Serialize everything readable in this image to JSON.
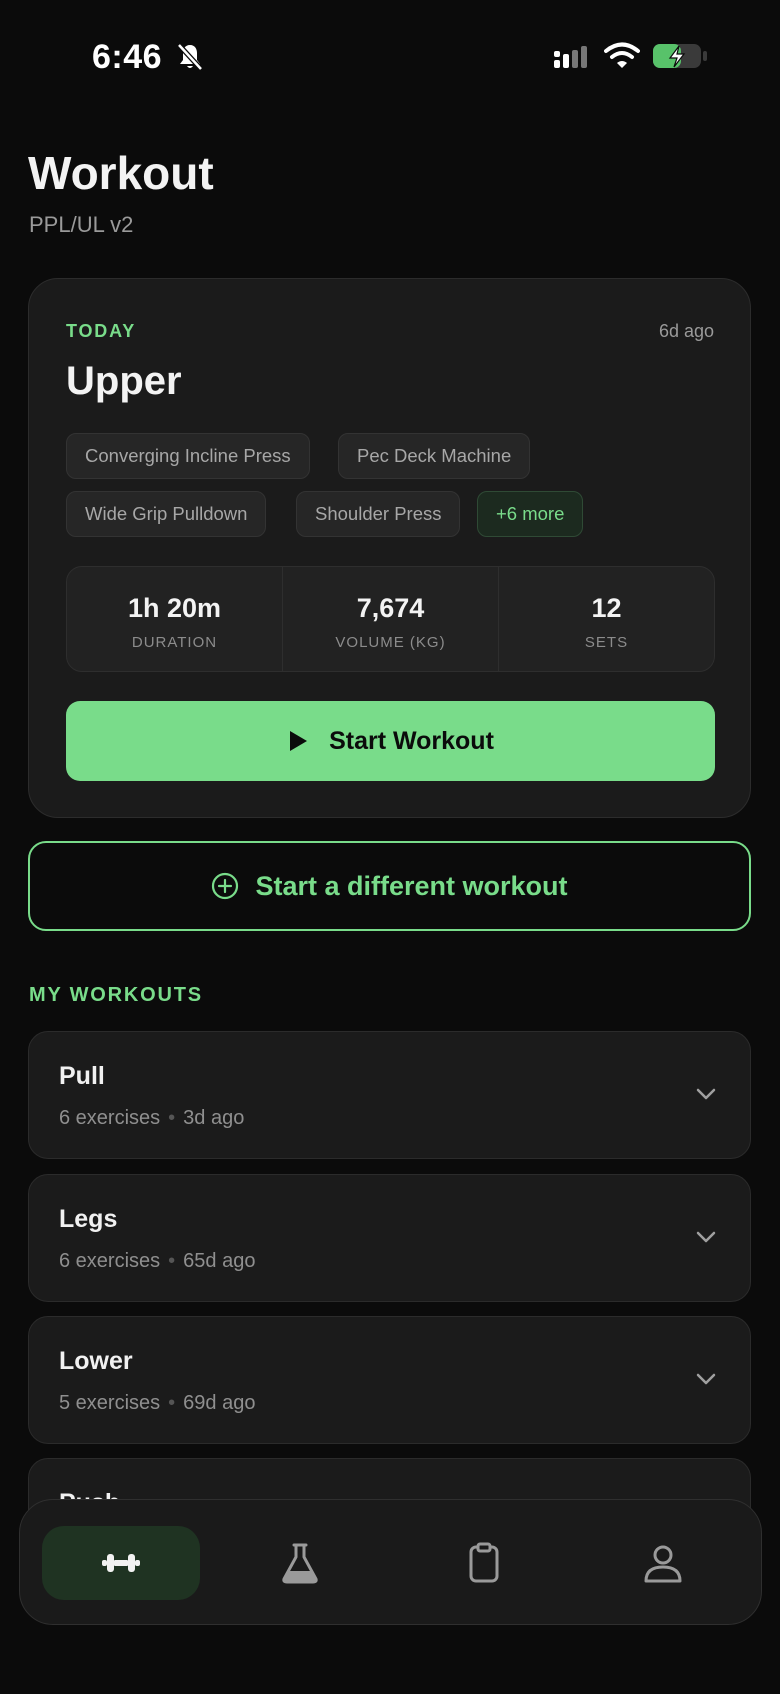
{
  "status_bar": {
    "time": "6:46",
    "icons": [
      "bell-off-icon",
      "signal-icon",
      "wifi-icon",
      "battery-charging-icon"
    ]
  },
  "header": {
    "title": "Workout",
    "subtitle": "PPL/UL v2"
  },
  "today": {
    "label": "TODAY",
    "ago": "6d ago",
    "name": "Upper",
    "exercises": [
      "Converging Incline Press",
      "Pec Deck Machine",
      "Wide Grip Pulldown",
      "Shoulder Press"
    ],
    "more": "+6 more",
    "stats": [
      {
        "value": "1h 20m",
        "label": "DURATION"
      },
      {
        "value": "7,674",
        "label": "VOLUME (KG)"
      },
      {
        "value": "12",
        "label": "SETS"
      }
    ],
    "start_label": "Start Workout"
  },
  "different_workout_label": "Start a different workout",
  "my_workouts": {
    "title": "MY WORKOUTS",
    "items": [
      {
        "name": "Pull",
        "exercises": "6 exercises",
        "ago": "3d ago"
      },
      {
        "name": "Legs",
        "exercises": "6 exercises",
        "ago": "65d ago"
      },
      {
        "name": "Lower",
        "exercises": "5 exercises",
        "ago": "69d ago"
      },
      {
        "name": "Push"
      }
    ]
  },
  "tab_bar": {
    "tabs": [
      {
        "icon": "dumbbell-icon",
        "active": true
      },
      {
        "icon": "flask-icon",
        "active": false
      },
      {
        "icon": "clipboard-icon",
        "active": false
      },
      {
        "icon": "user-icon",
        "active": false
      }
    ]
  },
  "colors": {
    "accent": "#79dc8a",
    "background": "#0b0b0b",
    "card": "#1b1b1b"
  }
}
